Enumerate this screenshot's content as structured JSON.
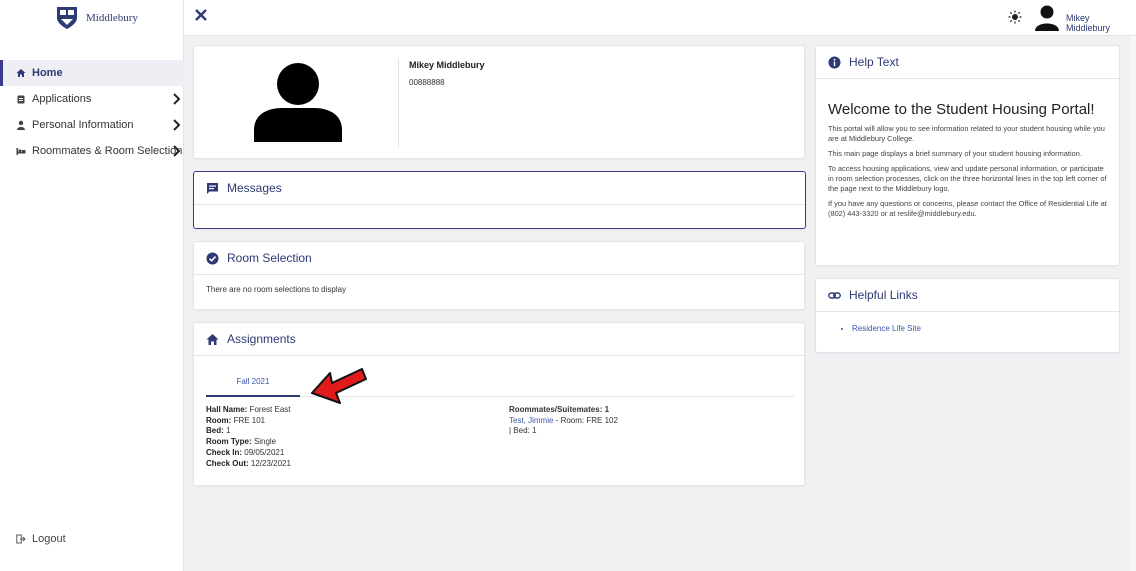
{
  "brand": {
    "name": "Middlebury"
  },
  "sidebar": {
    "items": [
      {
        "label": "Home",
        "icon": "home-icon",
        "active": true
      },
      {
        "label": "Applications",
        "icon": "clipboard-icon"
      },
      {
        "label": "Personal Information",
        "icon": "person-icon"
      },
      {
        "label": "Roommates & Room Selection",
        "icon": "bed-icon"
      }
    ],
    "logout_label": "Logout"
  },
  "topbar": {
    "user_name": "Mikey Middlebury"
  },
  "profile": {
    "name": "Mikey Middlebury",
    "id": "00888888"
  },
  "messages": {
    "title": "Messages"
  },
  "room_selection": {
    "title": "Room Selection",
    "empty_text": "There are no room selections to display"
  },
  "assignments": {
    "title": "Assignments",
    "tab_label": "Fall 2021",
    "hall_label": "Hall Name:",
    "hall_value": "Forest East",
    "room_label": "Room:",
    "room_value": "FRE 101",
    "bed_label": "Bed:",
    "bed_value": "1",
    "type_label": "Room Type:",
    "type_value": "Single",
    "checkin_label": "Check In:",
    "checkin_value": "09/05/2021",
    "checkout_label": "Check Out:",
    "checkout_value": "12/23/2021",
    "roommates_label": "Roommates/Suitemates:",
    "roommates_count": "1",
    "roommate_name": "Test, Jimmie",
    "roommate_room": " - Room: FRE 102",
    "roommate_bed": "| Bed: 1"
  },
  "help": {
    "title": "Help Text",
    "welcome": "Welcome to the Student Housing Portal!",
    "p1": "This portal will allow you to see information related to your student housing while you are at Middlebury College.",
    "p2": "This main page displays a brief summary of your student housing information.",
    "p3": "To access housing applications, view and update personal information, or participate in room selection processes, click on the three horizontal lines in the top left corner of the page next to the Middlebury logo.",
    "p4": "If you have any questions or concerns, please contact the Office of Residential Life at (802) 443-3320 or at reslife@middlebury.edu."
  },
  "helpful_links": {
    "title": "Helpful Links",
    "items": [
      "Residence Life Site"
    ]
  },
  "colors": {
    "accent": "#2d3a73",
    "link": "#3a56a8",
    "arrow": "#e11b1b"
  }
}
